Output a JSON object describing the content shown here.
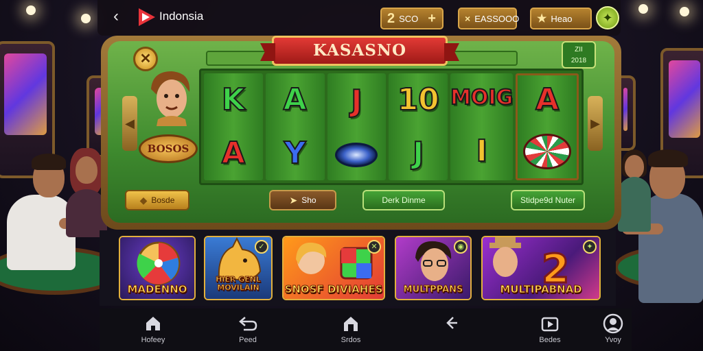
{
  "topbar": {
    "app_title": "Indonsia",
    "chips": [
      {
        "big": "2",
        "label": "SCO",
        "extra": "+"
      },
      {
        "big": "×",
        "label": "EASSOOO",
        "extra": ""
      },
      {
        "big": "★",
        "label": "Heao",
        "extra": ""
      }
    ]
  },
  "slot": {
    "title": "KASASNO",
    "level_line1": "ZII",
    "level_line2": "2018",
    "bonus_badge": "BOSOS",
    "reels": [
      {
        "top": "K",
        "bottom": "A",
        "top_color": "#3ed24a",
        "bottom_color": "#e6302b"
      },
      {
        "top": "A",
        "bottom": "Y",
        "top_color": "#3ed24a",
        "bottom_color": "#3b6cf0"
      },
      {
        "top": "J",
        "bottom": "",
        "top_color": "#e6302b",
        "bottom_color": ""
      },
      {
        "top": "10",
        "bottom": "J",
        "top_color": "#f2c230",
        "bottom_color": "#3ed24a"
      },
      {
        "top": "MOIG",
        "bottom": "I",
        "top_color": "#e6302b",
        "bottom_color": "#f2c230"
      },
      {
        "top": "A",
        "bottom": "",
        "top_color": "#e6302b",
        "bottom_color": ""
      }
    ],
    "buttons": {
      "left": "Bosde",
      "sho": "Sho",
      "dark": "Derk Dinme",
      "suggested": "Stidpe9d Nuter"
    }
  },
  "games": [
    {
      "label": "MADENNO"
    },
    {
      "label": "HIER GENL MOVILAIN"
    },
    {
      "label": "SNOSF DIVIAHES"
    },
    {
      "label": "MULTPPANS"
    },
    {
      "label": "MULTIPABNAD"
    }
  ],
  "nav": [
    {
      "label": "Hofeey",
      "icon": "home-icon"
    },
    {
      "label": "Peed",
      "icon": "undo-icon"
    },
    {
      "label": "Srdos",
      "icon": "store-icon"
    },
    {
      "label": "",
      "icon": "share-icon"
    },
    {
      "label": "Bedes",
      "icon": "play-icon"
    },
    {
      "label": "Yvoy",
      "icon": "profile-icon"
    }
  ],
  "colors": {
    "felt_green": "#3e8a2e",
    "gold": "#d9a64a",
    "ribbon_red": "#c42a25"
  }
}
